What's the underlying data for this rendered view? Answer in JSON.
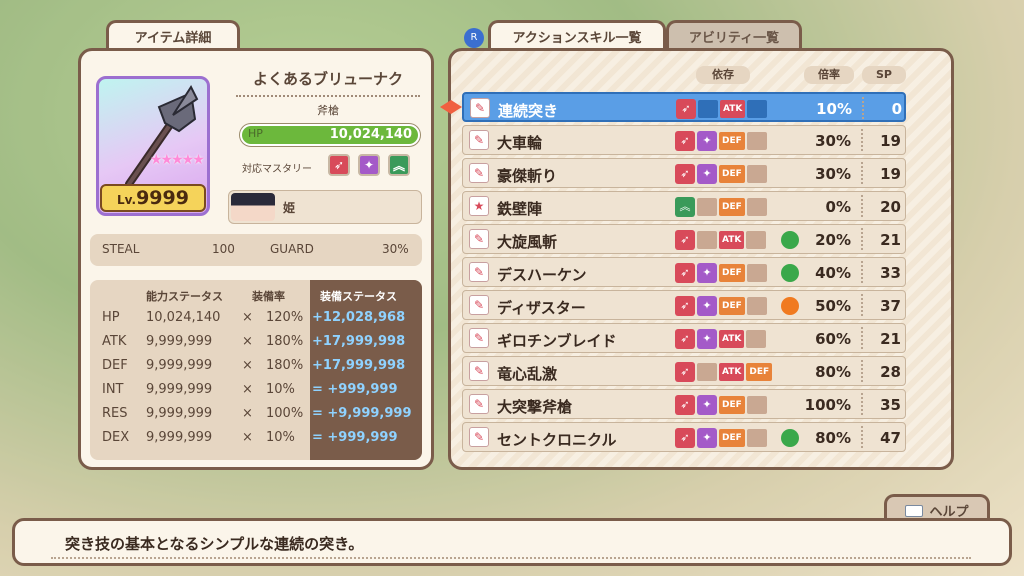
{
  "colors": {
    "accent_blue": "#5a9ee6",
    "panel_border": "#7a5c4a",
    "panel_bg": "#fbf5ea",
    "atk": "#d84a5a",
    "def": "#e8833a",
    "hp_green": "#6cb83c"
  },
  "left_tab": "アイテム詳細",
  "item": {
    "name": "よくあるブリューナク",
    "type": "斧槍",
    "hp_label": "HP",
    "hp_value": "10,024,140",
    "mastery_label": "対応マスタリー",
    "mastery_icons": [
      "spear-icon",
      "axe-icon",
      "chevron-up-icon"
    ],
    "level_prefix": "Lv.",
    "level": "9999",
    "stars": "★★★★★",
    "owner": "姫"
  },
  "steal": {
    "label": "STEAL",
    "value": "100",
    "guard_label": "GUARD",
    "guard_value": "30%"
  },
  "stats": {
    "headers": {
      "base": "能力ステータス",
      "rate": "装備率",
      "equip": "装備ステータス"
    },
    "rows": [
      {
        "name": "HP",
        "base": "10,024,140",
        "op": "×",
        "rate": "120%",
        "equip": "+12,028,968"
      },
      {
        "name": "ATK",
        "base": "9,999,999",
        "op": "×",
        "rate": "180%",
        "equip": "+17,999,998"
      },
      {
        "name": "DEF",
        "base": "9,999,999",
        "op": "×",
        "rate": "180%",
        "equip": "+17,999,998"
      },
      {
        "name": "INT",
        "base": "9,999,999",
        "op": "×",
        "rate": "10%",
        "equip": "= +999,999"
      },
      {
        "name": "RES",
        "base": "9,999,999",
        "op": "×",
        "rate": "100%",
        "equip": "= +9,999,999"
      },
      {
        "name": "DEX",
        "base": "9,999,999",
        "op": "×",
        "rate": "10%",
        "equip": "= +999,999"
      }
    ]
  },
  "tabs": {
    "active": "アクションスキル一覧",
    "inactive": "アビリティ一覧",
    "rb": "R"
  },
  "columns": {
    "deps": "依存",
    "mult": "倍率",
    "sp": "SP"
  },
  "skills": [
    {
      "name": "連続突き",
      "deps": [
        "spear"
      ],
      "stats": [
        "empty",
        "ATK",
        "empty"
      ],
      "elem": "",
      "mult": "10%",
      "sp": "0",
      "selected": true
    },
    {
      "name": "大車輪",
      "deps": [
        "spear",
        "axe"
      ],
      "stats": [
        "DEF",
        "empty"
      ],
      "elem": "",
      "mult": "30%",
      "sp": "19"
    },
    {
      "name": "豪傑斬り",
      "deps": [
        "spear",
        "axe"
      ],
      "stats": [
        "DEF",
        "empty"
      ],
      "elem": "",
      "mult": "30%",
      "sp": "19"
    },
    {
      "name": "鉄壁陣",
      "deps": [
        "chevron"
      ],
      "stats": [
        "empty",
        "DEF",
        "empty"
      ],
      "elem": "",
      "mult": "0%",
      "sp": "20"
    },
    {
      "name": "大旋風斬",
      "deps": [
        "spear"
      ],
      "stats": [
        "empty",
        "ATK",
        "empty"
      ],
      "elem": "wind",
      "mult": "20%",
      "sp": "21"
    },
    {
      "name": "デスハーケン",
      "deps": [
        "spear",
        "axe"
      ],
      "stats": [
        "DEF",
        "empty"
      ],
      "elem": "wind",
      "mult": "40%",
      "sp": "33"
    },
    {
      "name": "ディザスター",
      "deps": [
        "spear",
        "axe"
      ],
      "stats": [
        "DEF",
        "empty"
      ],
      "elem": "fire",
      "mult": "50%",
      "sp": "37"
    },
    {
      "name": "ギロチンブレイド",
      "deps": [
        "spear",
        "axe"
      ],
      "stats": [
        "ATK",
        "empty"
      ],
      "elem": "",
      "mult": "60%",
      "sp": "21"
    },
    {
      "name": "竜心乱激",
      "deps": [
        "spear"
      ],
      "stats": [
        "empty",
        "ATK",
        "DEF"
      ],
      "elem": "",
      "mult": "80%",
      "sp": "28"
    },
    {
      "name": "大突撃斧槍",
      "deps": [
        "spear",
        "axe"
      ],
      "stats": [
        "DEF",
        "empty"
      ],
      "elem": "",
      "mult": "100%",
      "sp": "35"
    },
    {
      "name": "セントクロニクル",
      "deps": [
        "spear",
        "axe"
      ],
      "stats": [
        "DEF",
        "empty"
      ],
      "elem": "wind",
      "mult": "80%",
      "sp": "47"
    }
  ],
  "help": "ヘルプ",
  "description": "突き技の基本となるシンプルな連続の突き。"
}
